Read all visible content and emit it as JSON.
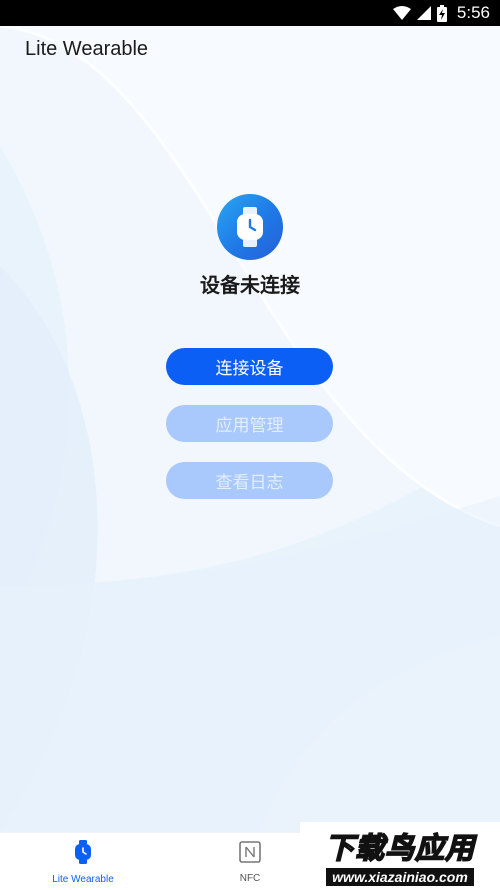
{
  "status_bar": {
    "time": "5:56",
    "icons": [
      "wifi-icon",
      "signal-icon",
      "battery-charging-icon"
    ]
  },
  "app": {
    "title": "Lite Wearable"
  },
  "device": {
    "icon": "watch-icon",
    "status": "设备未连接"
  },
  "actions": {
    "connect": "连接设备",
    "app_management": "应用管理",
    "view_logs": "查看日志"
  },
  "tabs": [
    {
      "label": "Lite Wearable",
      "icon": "watch-icon",
      "active": true
    },
    {
      "label": "NFC",
      "icon": "nfc-icon",
      "active": false
    }
  ],
  "watermark": {
    "title": "下载鸟应用",
    "url": "www.xiazainiao.com"
  },
  "colors": {
    "primary": "#0c5ff5",
    "disabled": "#a9c8fb",
    "background": "#f3f8fd"
  }
}
